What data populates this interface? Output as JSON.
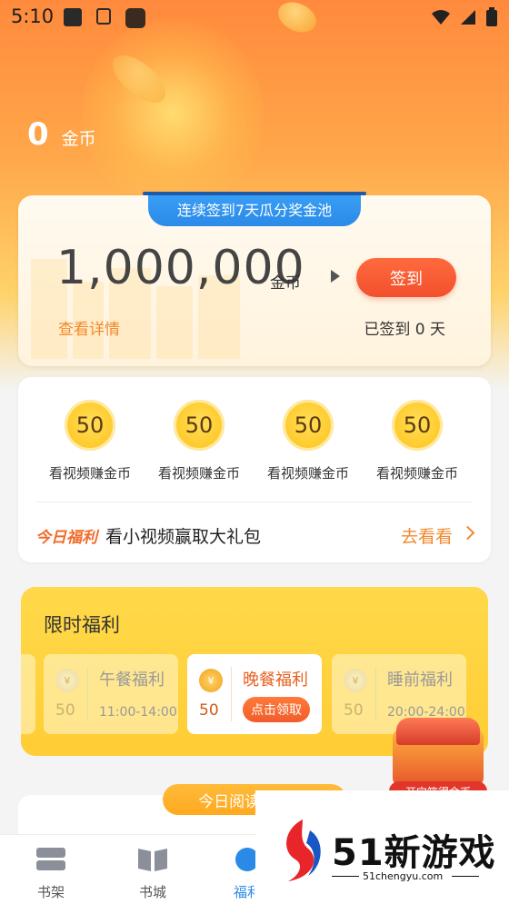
{
  "status_bar": {
    "time": "5:10"
  },
  "header": {
    "coins": "0",
    "coins_unit": "金币"
  },
  "checkin": {
    "ribbon": "连续签到7天瓜分奖金池",
    "pool_amount": "1,000,000",
    "pool_unit": "金币",
    "sign_button": "签到",
    "detail_link": "查看详情",
    "signed_days": "已签到 0 天"
  },
  "video_tasks": {
    "items": [
      {
        "amount": "50",
        "label": "看视频赚金币"
      },
      {
        "amount": "50",
        "label": "看视频赚金币"
      },
      {
        "amount": "50",
        "label": "看视频赚金币"
      },
      {
        "amount": "50",
        "label": "看视频赚金币"
      }
    ],
    "today_tag": "今日福利",
    "today_text": "看小视频赢取大礼包",
    "goto_label": "去看看"
  },
  "limited": {
    "title": "限时福利",
    "coin_symbol": "¥",
    "meals": [
      {
        "name": "午餐福利",
        "amount": "50",
        "time": "11:00-14:00"
      },
      {
        "name": "晚餐福利",
        "amount": "50",
        "action": "点击领取"
      },
      {
        "name": "睡前福利",
        "amount": "50",
        "time": "20:00-24:00"
      }
    ]
  },
  "chest": {
    "label": "开宝箱得金币"
  },
  "reading": {
    "pill": "今日阅读 0 分钟"
  },
  "tabbar": {
    "items": [
      {
        "label": "书架"
      },
      {
        "label": "书城"
      },
      {
        "label": "福利"
      }
    ],
    "active_index": 2
  },
  "watermark": {
    "brand": "51新游戏",
    "url": "51chengyu.com"
  },
  "colors": {
    "accent_orange": "#f2502d",
    "accent_blue": "#2b8ae8",
    "gold": "#ffcd35"
  }
}
